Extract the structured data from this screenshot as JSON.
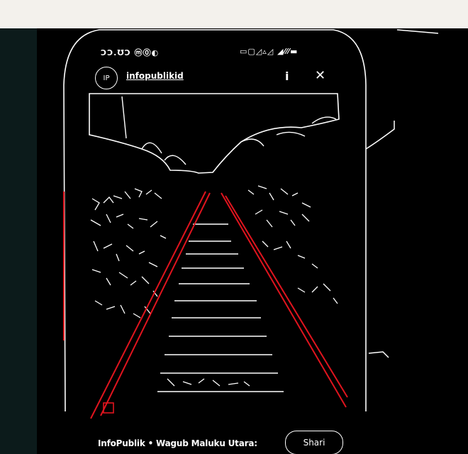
{
  "status": {
    "left": "ƆƆ.ƱƆ ⓜ⓪◐",
    "right": "▭▢◿▵◿ ◢⁄⁄⁄▬"
  },
  "post": {
    "account_name": "infopublikid",
    "avatar_text": "IP",
    "caption": "InfoPublik • Wagub Maluku Utara:",
    "share_label": "Shari"
  },
  "icons": {
    "info": "info-icon",
    "close": "close-icon"
  },
  "colors": {
    "background": "#000000",
    "edges": "#ffffff",
    "rails": "#e0141e",
    "frame": "#f3f1ec"
  }
}
